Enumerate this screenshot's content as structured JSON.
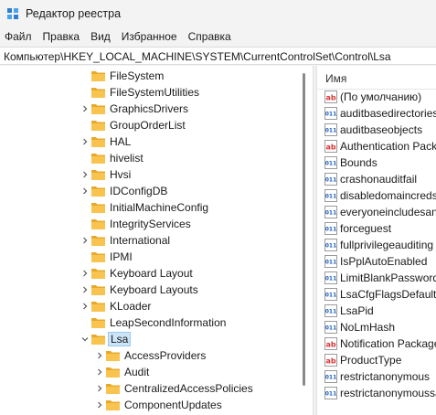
{
  "window": {
    "title": "Редактор реестра"
  },
  "menu": [
    "Файл",
    "Правка",
    "Вид",
    "Избранное",
    "Справка"
  ],
  "address": "Компьютер\\HKEY_LOCAL_MACHINE\\SYSTEM\\CurrentControlSet\\Control\\Lsa",
  "tree": [
    {
      "label": "FileSystem",
      "level": 0,
      "expander": "none"
    },
    {
      "label": "FileSystemUtilities",
      "level": 0,
      "expander": "none"
    },
    {
      "label": "GraphicsDrivers",
      "level": 0,
      "expander": "collapsed"
    },
    {
      "label": "GroupOrderList",
      "level": 0,
      "expander": "none"
    },
    {
      "label": "HAL",
      "level": 0,
      "expander": "collapsed"
    },
    {
      "label": "hivelist",
      "level": 0,
      "expander": "none"
    },
    {
      "label": "Hvsi",
      "level": 0,
      "expander": "collapsed"
    },
    {
      "label": "IDConfigDB",
      "level": 0,
      "expander": "collapsed"
    },
    {
      "label": "InitialMachineConfig",
      "level": 0,
      "expander": "none"
    },
    {
      "label": "IntegrityServices",
      "level": 0,
      "expander": "none"
    },
    {
      "label": "International",
      "level": 0,
      "expander": "collapsed"
    },
    {
      "label": "IPMI",
      "level": 0,
      "expander": "none"
    },
    {
      "label": "Keyboard Layout",
      "level": 0,
      "expander": "collapsed"
    },
    {
      "label": "Keyboard Layouts",
      "level": 0,
      "expander": "collapsed"
    },
    {
      "label": "KLoader",
      "level": 0,
      "expander": "collapsed"
    },
    {
      "label": "LeapSecondInformation",
      "level": 0,
      "expander": "none"
    },
    {
      "label": "Lsa",
      "level": 0,
      "expander": "expanded",
      "selected": true
    },
    {
      "label": "AccessProviders",
      "level": 1,
      "expander": "collapsed"
    },
    {
      "label": "Audit",
      "level": 1,
      "expander": "collapsed"
    },
    {
      "label": "CentralizedAccessPolicies",
      "level": 1,
      "expander": "collapsed"
    },
    {
      "label": "ComponentUpdates",
      "level": 1,
      "expander": "collapsed"
    }
  ],
  "values_header": "Имя",
  "values": [
    {
      "name": "(По умолчанию)",
      "type": "string"
    },
    {
      "name": "auditbasedirectories",
      "type": "binary"
    },
    {
      "name": "auditbaseobjects",
      "type": "binary"
    },
    {
      "name": "Authentication Packages",
      "type": "string"
    },
    {
      "name": "Bounds",
      "type": "binary"
    },
    {
      "name": "crashonauditfail",
      "type": "binary"
    },
    {
      "name": "disabledomaincreds",
      "type": "binary"
    },
    {
      "name": "everyoneincludesanonymous",
      "type": "binary"
    },
    {
      "name": "forceguest",
      "type": "binary"
    },
    {
      "name": "fullprivilegeauditing",
      "type": "binary"
    },
    {
      "name": "IsPplAutoEnabled",
      "type": "binary"
    },
    {
      "name": "LimitBlankPasswordUse",
      "type": "binary"
    },
    {
      "name": "LsaCfgFlagsDefault",
      "type": "binary"
    },
    {
      "name": "LsaPid",
      "type": "binary"
    },
    {
      "name": "NoLmHash",
      "type": "binary"
    },
    {
      "name": "Notification Packages",
      "type": "string"
    },
    {
      "name": "ProductType",
      "type": "string"
    },
    {
      "name": "restrictanonymous",
      "type": "binary"
    },
    {
      "name": "restrictanonymoussam",
      "type": "binary"
    }
  ],
  "colors": {
    "folder": "#f8c44f",
    "folder_dark": "#e8a92a",
    "selection": "#cce4f7",
    "string_icon": "#d33",
    "binary_icon": "#1f5fbf"
  }
}
